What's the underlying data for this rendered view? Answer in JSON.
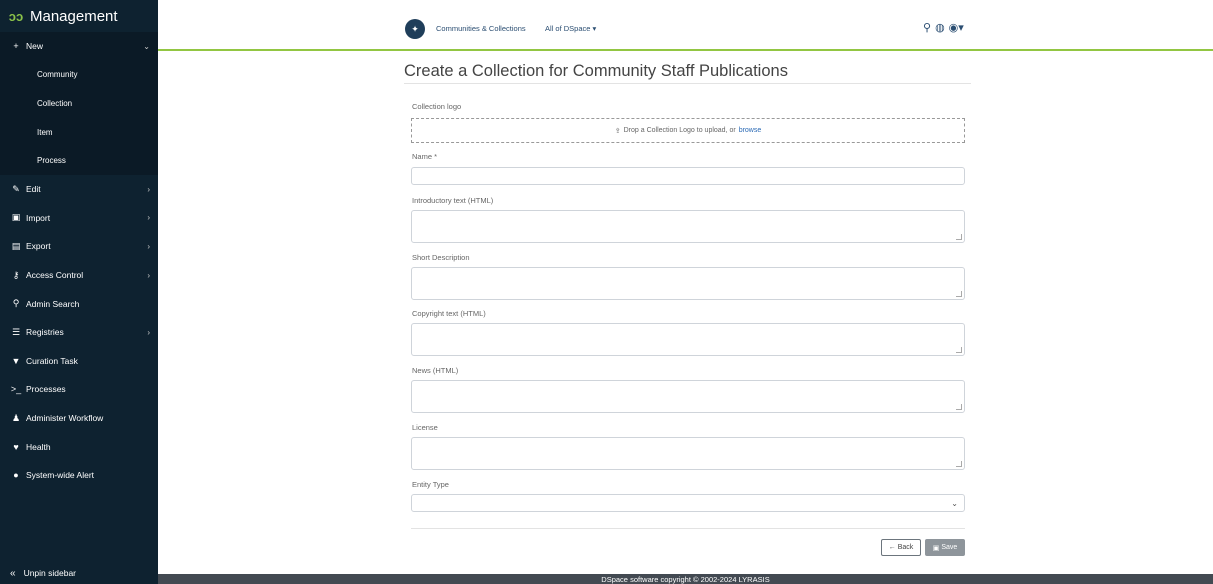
{
  "sidebar": {
    "title": "Management",
    "new_label": "New",
    "new_items": [
      "Community",
      "Collection",
      "Item",
      "Process"
    ],
    "items": [
      {
        "label": "Edit"
      },
      {
        "label": "Import"
      },
      {
        "label": "Export"
      },
      {
        "label": "Access Control"
      },
      {
        "label": "Admin Search"
      },
      {
        "label": "Registries"
      },
      {
        "label": "Curation Task"
      },
      {
        "label": "Processes"
      },
      {
        "label": "Administer Workflow"
      },
      {
        "label": "Health"
      },
      {
        "label": "System-wide Alert"
      }
    ],
    "unpin_label": "Unpin sidebar"
  },
  "header": {
    "nav_communities": "Communities & Collections",
    "nav_all": "All of DSpace ▾"
  },
  "form": {
    "title": "Create a Collection for Community Staff Publications",
    "logo_label": "Collection logo",
    "drop_text": "Drop a Collection Logo to upload, or",
    "browse_text": "browse",
    "name_label": "Name *",
    "intro_label": "Introductory text (HTML)",
    "short_label": "Short Description",
    "copyright_label": "Copyright text (HTML)",
    "news_label": "News (HTML)",
    "license_label": "License",
    "entity_label": "Entity Type",
    "back_label": "Back",
    "save_label": "Save"
  },
  "footer": {
    "text": "DSpace software copyright © 2002-2024 LYRASIS"
  }
}
